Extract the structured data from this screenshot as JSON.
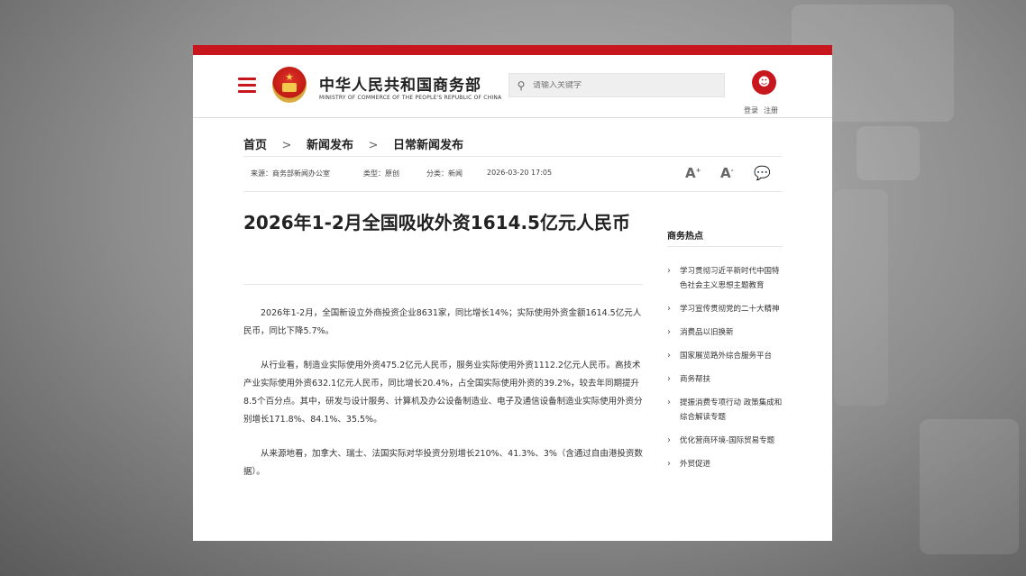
{
  "header": {
    "site_name": "中华人民共和国商务部",
    "site_subtitle": "MINISTRY OF COMMERCE OF THE PEOPLE'S REPUBLIC OF CHINA",
    "search_placeholder": "请输入关键字",
    "login_label": "登录",
    "register_label": "注册"
  },
  "breadcrumb": {
    "items": [
      "首页",
      "新闻发布",
      "日常新闻发布"
    ],
    "separator": ">"
  },
  "meta": {
    "source": "来源：商务部新闻办公室",
    "type": "类型：原创",
    "category": "分类：新闻",
    "datetime": "2026-03-20 17:05",
    "font_large_label": "A",
    "font_small_label": "A",
    "font_large_sign": "+",
    "font_small_sign": "-"
  },
  "article": {
    "title": "2026年1-2月全国吸收外资1614.5亿元人民币",
    "paragraphs": [
      "2026年1-2月，全国新设立外商投资企业8631家，同比增长14%；实际使用外资金额1614.5亿元人民币，同比下降5.7%。",
      "从行业看，制造业实际使用外资475.2亿元人民币，服务业实际使用外资1112.2亿元人民币。高技术产业实际使用外资632.1亿元人民币，同比增长20.4%，占全国实际使用外资的39.2%，较去年同期提升8.5个百分点。其中，研发与设计服务、计算机及办公设备制造业、电子及通信设备制造业实际使用外资分别增长171.8%、84.1%、35.5%。",
      "从来源地看，加拿大、瑞士、法国实际对华投资分别增长210%、41.3%、3%（含通过自由港投资数据）。"
    ]
  },
  "sidebar": {
    "title": "商务热点",
    "items": [
      "学习贯彻习近平新时代中国特色社会主义思想主题教育",
      "学习宣传贯彻党的二十大精神",
      "消费品以旧换新",
      "国家展览路外综合服务平台",
      "商务帮扶",
      "提振消费专项行动 政策集成和综合解读专题",
      "优化营商环境-国际贸易专题",
      "外贸促进"
    ]
  },
  "icons": {
    "menu": "menu-icon",
    "emblem": "national-emblem-icon",
    "search": "search-icon",
    "user": "user-icon",
    "wechat": "wechat-icon"
  },
  "colors": {
    "accent": "#c8161e"
  }
}
